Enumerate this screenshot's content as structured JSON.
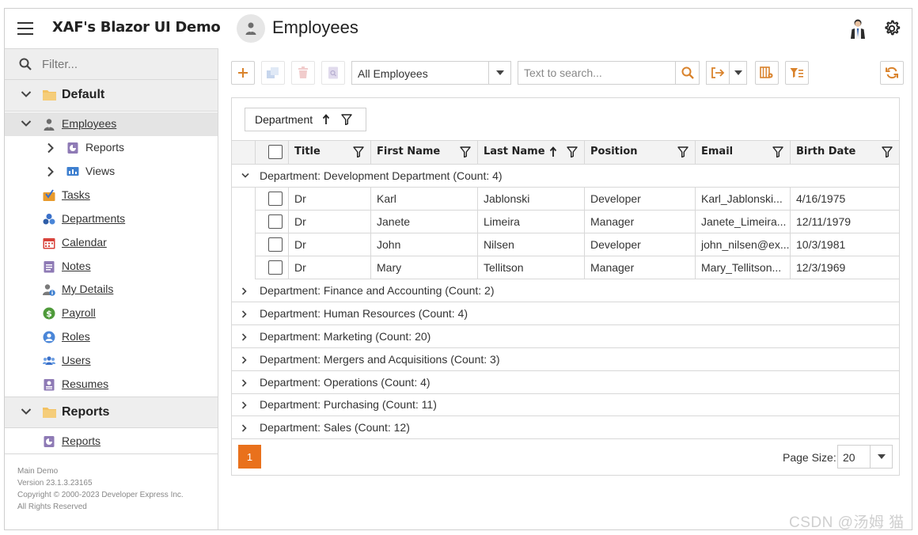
{
  "header": {
    "app_title": "XAF's Blazor UI Demo",
    "view_title": "Employees"
  },
  "sidebar": {
    "filter_placeholder": "Filter...",
    "groups": [
      {
        "label": "Default",
        "items": [
          {
            "label": "Employees",
            "icon": "employee-icon",
            "selected": true
          },
          {
            "label": "Reports",
            "icon": "reports-icon",
            "child": true
          },
          {
            "label": "Views",
            "icon": "views-icon",
            "child": true
          },
          {
            "label": "Tasks",
            "icon": "tasks-icon"
          },
          {
            "label": "Departments",
            "icon": "departments-icon"
          },
          {
            "label": "Calendar",
            "icon": "calendar-icon"
          },
          {
            "label": "Notes",
            "icon": "notes-icon"
          },
          {
            "label": "My Details",
            "icon": "my-details-icon"
          },
          {
            "label": "Payroll",
            "icon": "payroll-icon"
          },
          {
            "label": "Roles",
            "icon": "roles-icon"
          },
          {
            "label": "Users",
            "icon": "users-icon"
          },
          {
            "label": "Resumes",
            "icon": "resumes-icon"
          }
        ]
      },
      {
        "label": "Reports",
        "items": [
          {
            "label": "Reports",
            "icon": "reports-icon"
          }
        ]
      }
    ],
    "footer": [
      "Main Demo",
      "Version 23.1.3.23165",
      "Copyright © 2000-2023 Developer Express Inc.",
      "All Rights Reserved"
    ]
  },
  "toolbar": {
    "filter_combo_value": "All Employees",
    "search_placeholder": "Text to search..."
  },
  "grid": {
    "group_by_chip": "Department",
    "columns": [
      "Title",
      "First Name",
      "Last Name",
      "Position",
      "Email",
      "Birth Date"
    ],
    "groups": [
      {
        "label": "Department: Development Department (Count: 4)",
        "expanded": true,
        "rows": [
          [
            "Dr",
            "Karl",
            "Jablonski",
            "Developer",
            "Karl_Jablonski...",
            "4/16/1975"
          ],
          [
            "Dr",
            "Janete",
            "Limeira",
            "Manager",
            "Janete_Limeira...",
            "12/11/1979"
          ],
          [
            "Dr",
            "John",
            "Nilsen",
            "Developer",
            "john_nilsen@ex...",
            "10/3/1981"
          ],
          [
            "Dr",
            "Mary",
            "Tellitson",
            "Manager",
            "Mary_Tellitson...",
            "12/3/1969"
          ]
        ]
      },
      {
        "label": "Department: Finance and Accounting (Count: 2)",
        "expanded": false
      },
      {
        "label": "Department: Human Resources (Count: 4)",
        "expanded": false
      },
      {
        "label": "Department: Marketing (Count: 20)",
        "expanded": false
      },
      {
        "label": "Department: Mergers and Acquisitions (Count: 3)",
        "expanded": false
      },
      {
        "label": "Department: Operations (Count: 4)",
        "expanded": false
      },
      {
        "label": "Department: Purchasing (Count: 11)",
        "expanded": false
      },
      {
        "label": "Department: Sales (Count: 12)",
        "expanded": false
      }
    ],
    "pager": {
      "current_page": "1",
      "page_size_label": "Page Size:",
      "page_size": "20"
    }
  },
  "watermark": "CSDN @汤姆 猫",
  "colors": {
    "accent": "#e9711c",
    "toolbar_icon": "#d9822b"
  }
}
